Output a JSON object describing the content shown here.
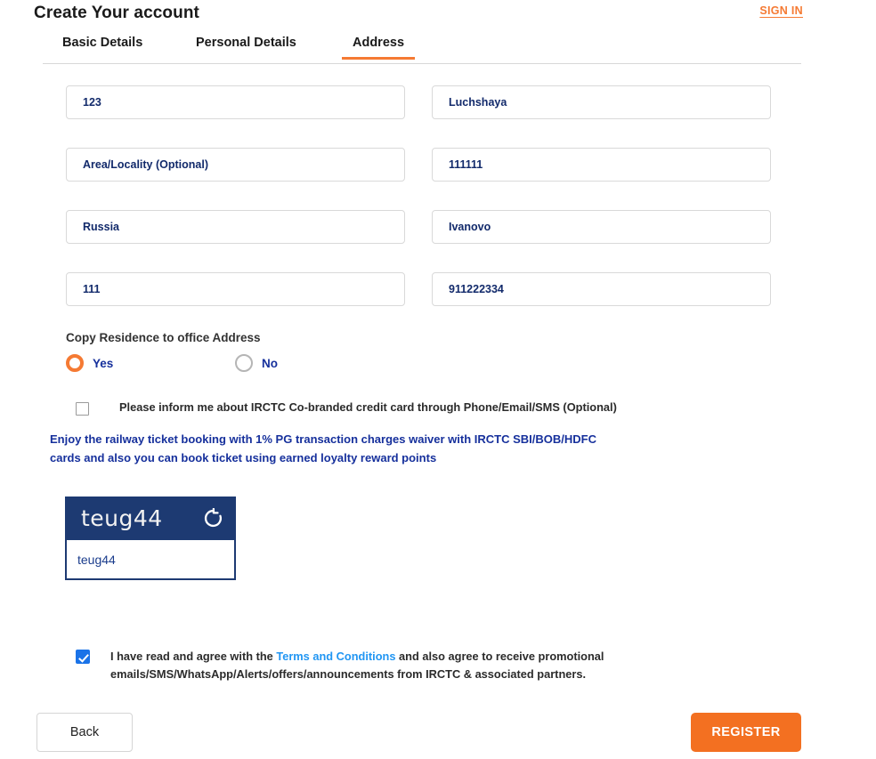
{
  "header": {
    "title": "Create Your account",
    "signin_label": "SIGN IN"
  },
  "tabs": [
    {
      "label": "Basic Details",
      "active": false
    },
    {
      "label": "Personal Details",
      "active": false
    },
    {
      "label": "Address",
      "active": true
    }
  ],
  "form": {
    "fields": [
      {
        "name": "flat-door-block",
        "value": "123",
        "placeholder": ""
      },
      {
        "name": "street-lane",
        "value": "Luchshaya",
        "placeholder": ""
      },
      {
        "name": "area-locality",
        "value": "",
        "placeholder": "Area/Locality (Optional)"
      },
      {
        "name": "pin-code",
        "value": "111111",
        "placeholder": ""
      },
      {
        "name": "country",
        "value": "Russia",
        "placeholder": ""
      },
      {
        "name": "city",
        "value": "Ivanovo",
        "placeholder": ""
      },
      {
        "name": "post-office",
        "value": "111",
        "placeholder": ""
      },
      {
        "name": "phone",
        "value": "911222334",
        "placeholder": ""
      }
    ]
  },
  "copy_residence": {
    "label": "Copy Residence to office Address",
    "yes_label": "Yes",
    "no_label": "No",
    "selected": "Yes"
  },
  "credit_card": {
    "checked": false,
    "label": "Please inform me about IRCTC Co-branded credit card through Phone/Email/SMS (Optional)",
    "promo_line_1": "Enjoy the railway ticket booking with 1% PG transaction charges waiver with IRCTC SBI/BOB/HDFC",
    "promo_line_2": "cards and also you can book ticket using earned loyalty reward points"
  },
  "captcha": {
    "code": "teug44",
    "input_value": "teug44",
    "refresh_icon": "refresh-icon"
  },
  "terms": {
    "checked": true,
    "text_before": "I have read and agree with the",
    "link_label": "Terms and Conditions",
    "text_after": "and also agree to receive promotional emails/SMS/WhatsApp/Alerts/offers/announcements from IRCTC & associated partners."
  },
  "footer": {
    "back_label": "Back",
    "register_label": "REGISTER"
  },
  "colors": {
    "accent_orange": "#F37021",
    "signin_orange": "#F57A33",
    "navy": "#1d3a72",
    "field_text_navy": "#122a6b",
    "promo_blue": "#16309c",
    "link_blue": "#2196F3",
    "checkbox_blue": "#1a73e8"
  }
}
